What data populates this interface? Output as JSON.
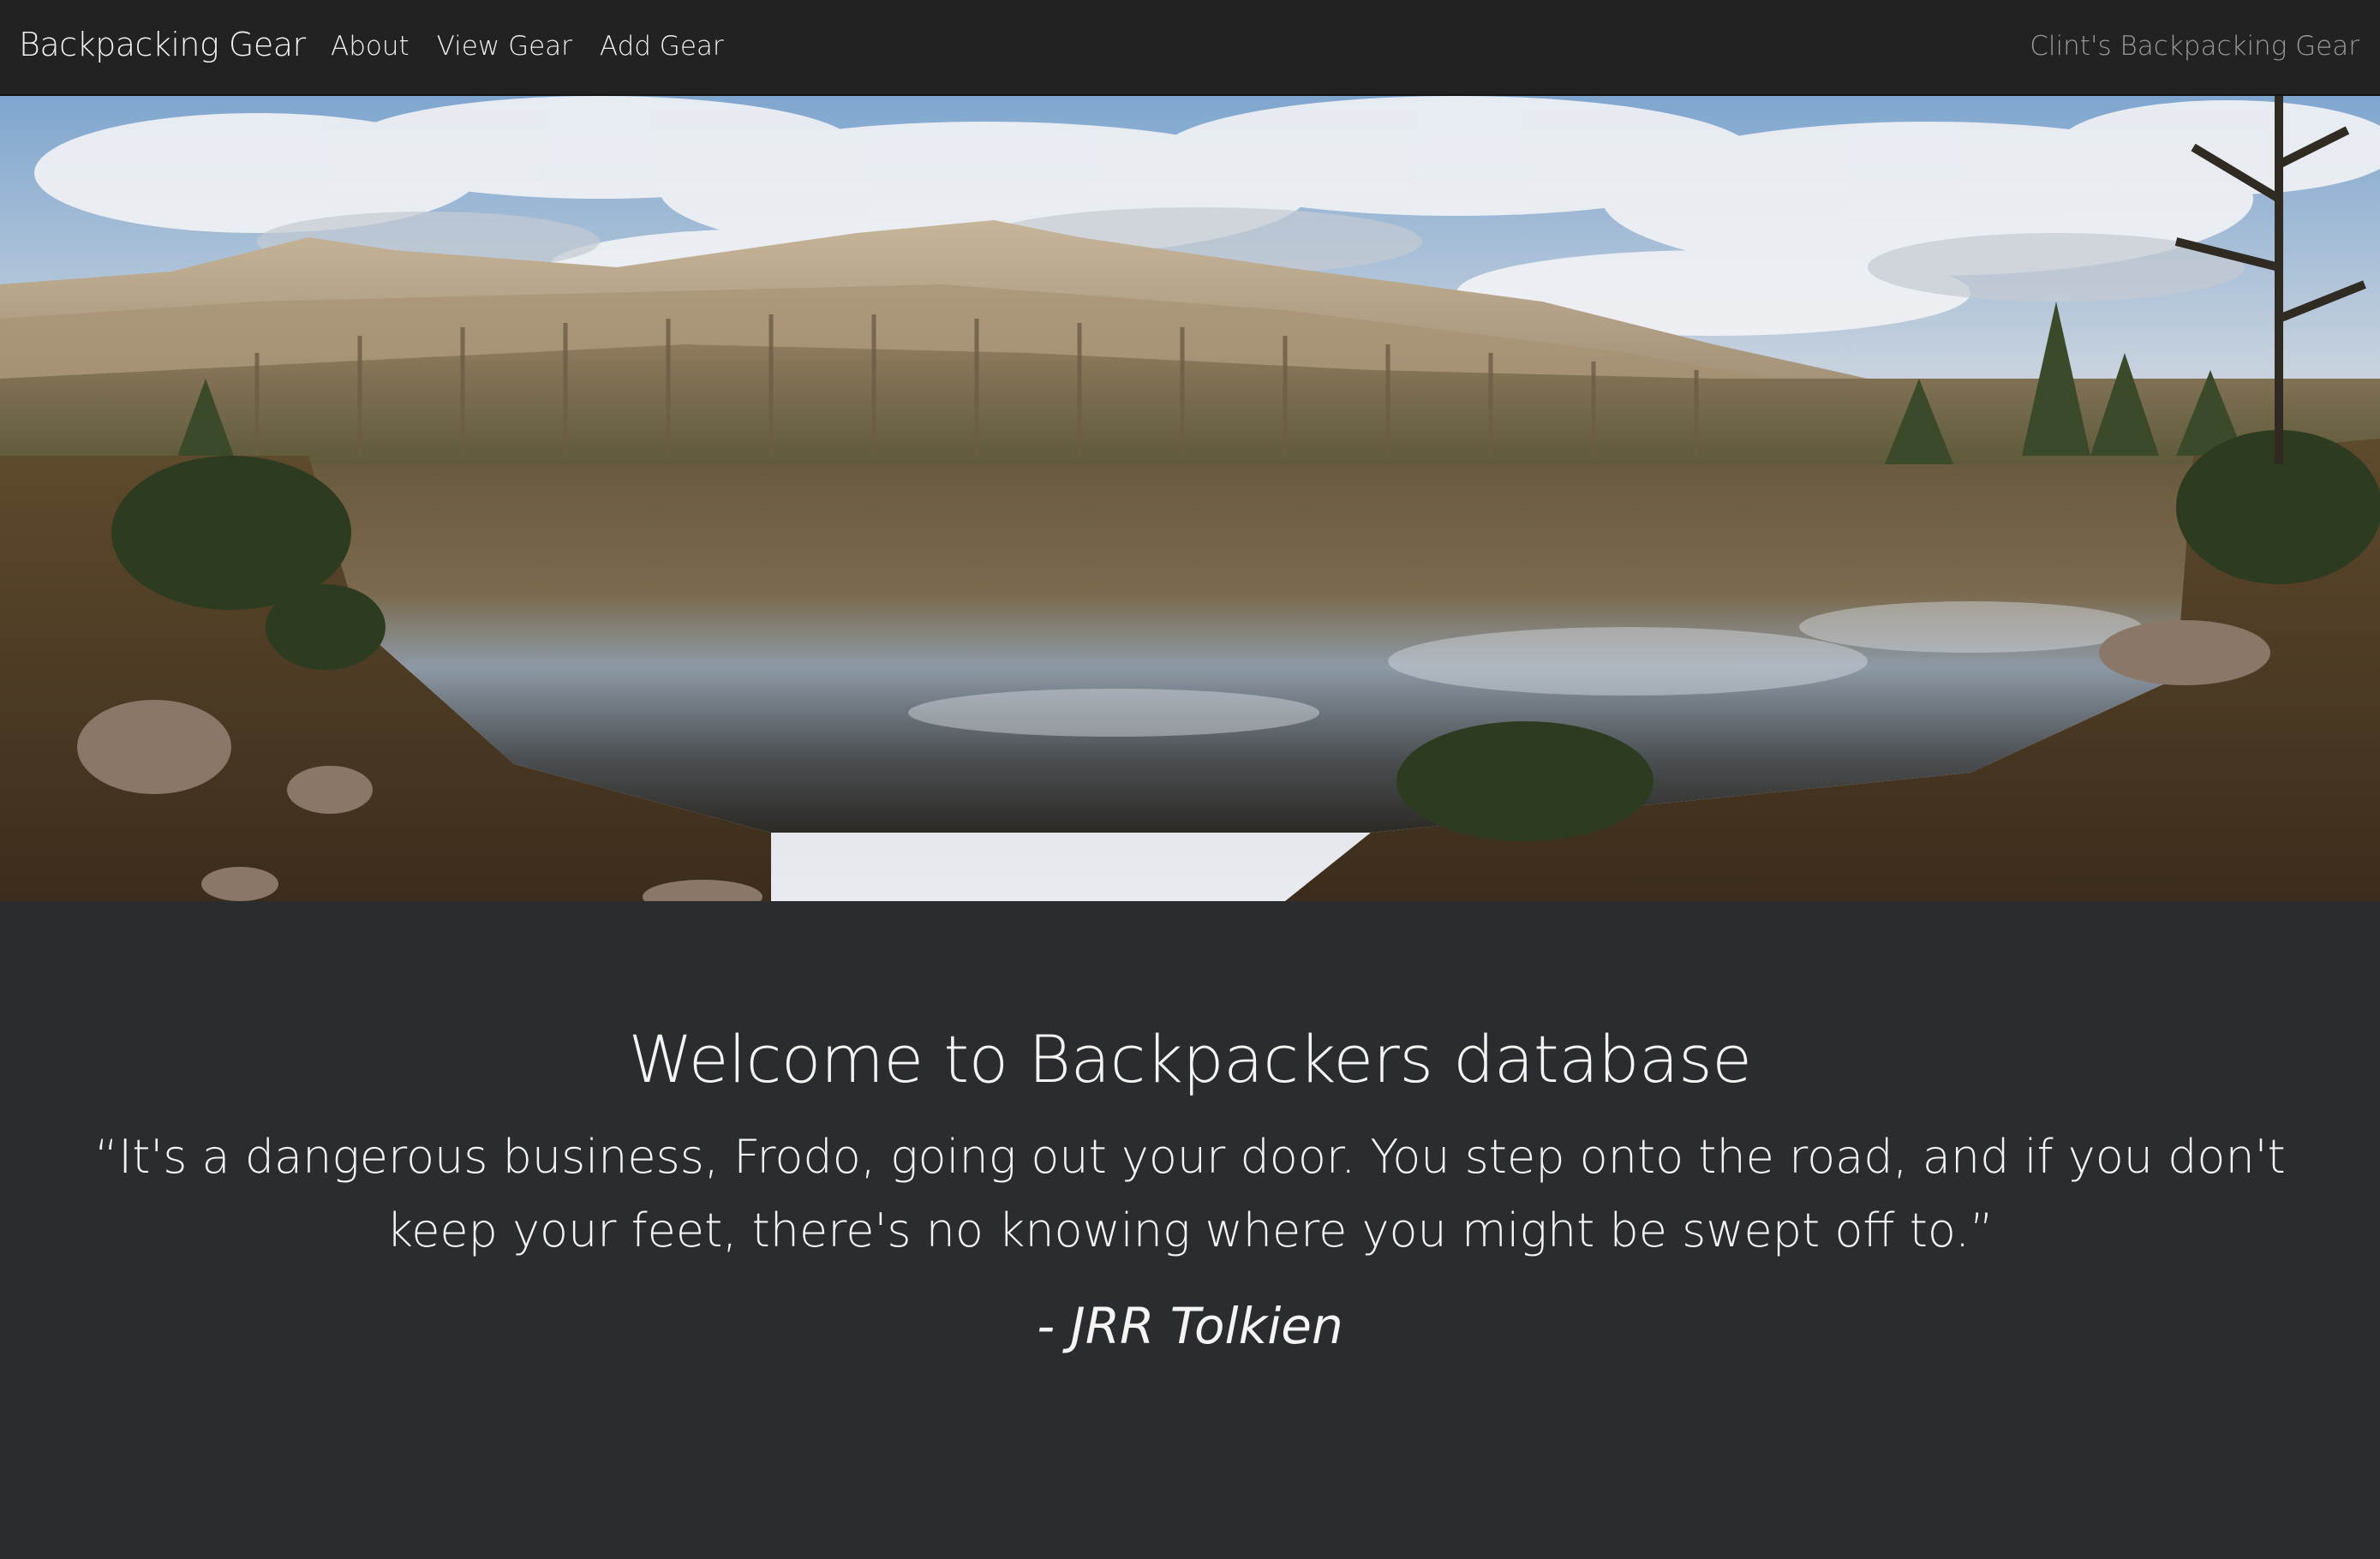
{
  "navbar": {
    "brand": "Backpacking Gear",
    "links": [
      "About",
      "View Gear",
      "Add Gear"
    ],
    "right_text": "Clint's Backpacking Gear"
  },
  "hero": {
    "image_description": "panorama-mountain-lake"
  },
  "main": {
    "heading": "Welcome to Backpackers database",
    "quote": "“It's a dangerous business, Frodo, going out your door. You step onto the road, and if you don't keep your feet, there's no knowing where you might be swept off to.”",
    "author": "- JRR Tolkien"
  },
  "colors": {
    "navbar_bg": "#222222",
    "page_bg": "#2b2c30",
    "text": "#f4f4f4",
    "muted": "#9a9a9a"
  }
}
